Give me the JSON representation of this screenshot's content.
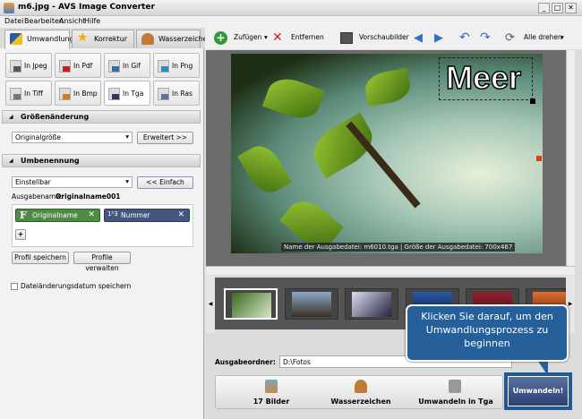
{
  "window": {
    "title": "m6.jpg - AVS Image Converter"
  },
  "menu": [
    "Datei",
    "Bearbeiten",
    "Ansicht",
    "Hilfe"
  ],
  "tabs": [
    "Umwandlung",
    "Korrektur",
    "Wasserzeichen"
  ],
  "formats": [
    "In Jpeg",
    "In Pdf",
    "In Gif",
    "In Png",
    "In Tiff",
    "In Bmp",
    "In Tga",
    "In Ras"
  ],
  "resize": {
    "header": "Größenänderung",
    "select": "Originalgröße",
    "advanced": "Erweitert >>"
  },
  "rename": {
    "header": "Umbenennung",
    "select": "Einstellbar",
    "simple": "<< Einfach",
    "output_label": "Ausgabename:",
    "output_value": "Originalname001",
    "tags": [
      "Originalname",
      "Nummer"
    ],
    "add": "+",
    "save_profile": "Profil speichern",
    "manage_profiles": "Profile verwalten"
  },
  "keep_date": "Dateiänderungsdatum speichern",
  "toolbar": {
    "add": "Zufügen",
    "remove": "Entfernen",
    "thumbnails": "Vorschaubilder",
    "rotate_all": "Alle drehen"
  },
  "preview": {
    "watermark_text": "Meer",
    "caption": "Name der Ausgabedatei: m6010.tga | Größe der Ausgabedatei: 700x467"
  },
  "output": {
    "label": "Ausgabeordner:",
    "path": "D:\\Fotos"
  },
  "steps": [
    "17 Bilder",
    "Wasserzeichen",
    "Umwandeln in Tga"
  ],
  "convert": "Umwandeln!",
  "callout": "Klicken Sie darauf, um den Umwandlungsprozess zu beginnen",
  "colors": {
    "callout": "#25609a",
    "tag_green": "#4f8a47",
    "tag_blue": "#44557e"
  }
}
